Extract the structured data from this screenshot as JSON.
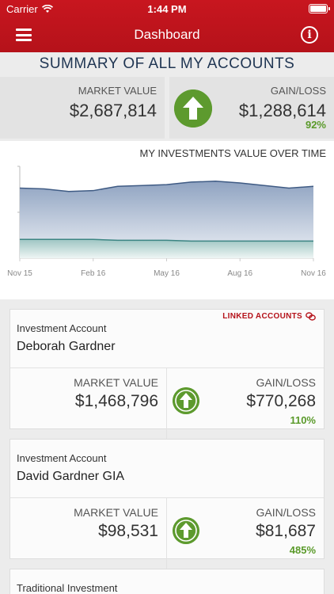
{
  "status": {
    "carrier": "Carrier",
    "time": "1:44 PM"
  },
  "header": {
    "title": "Dashboard"
  },
  "summary": {
    "title": "SUMMARY OF ALL MY ACCOUNTS",
    "market_value_label": "MARKET VALUE",
    "market_value": "$2,687,814",
    "gain_loss_label": "GAIN/LOSS",
    "gain_loss": "$1,288,614",
    "gain_loss_pct": "92%"
  },
  "chart_data": {
    "type": "area",
    "title": "MY INVESTMENTS VALUE OVER TIME",
    "x_tick_labels": [
      "Nov 15",
      "Feb 16",
      "May 16",
      "Aug 16",
      "Nov 16"
    ],
    "x_points": [
      "Nov 15",
      "Dec 15",
      "Jan 16",
      "Feb 16",
      "Mar 16",
      "Apr 16",
      "May 16",
      "Jun 16",
      "Jul 16",
      "Aug 16",
      "Sep 16",
      "Oct 16",
      "Nov 16"
    ],
    "series": [
      {
        "values": [
          0.82,
          0.81,
          0.78,
          0.79,
          0.84,
          0.85,
          0.86,
          0.89,
          0.9,
          0.88,
          0.85,
          0.82,
          0.84
        ],
        "color": "#3f5b84"
      },
      {
        "values": [
          0.22,
          0.22,
          0.22,
          0.22,
          0.21,
          0.21,
          0.21,
          0.2,
          0.2,
          0.2,
          0.2,
          0.2,
          0.2
        ],
        "color": "#3c8583"
      }
    ]
  },
  "accounts": [
    {
      "type": "Investment Account",
      "name": "Deborah Gardner",
      "linked_label": "LINKED ACCOUNTS",
      "market_value_label": "MARKET VALUE",
      "market_value": "$1,468,796",
      "gain_loss_label": "GAIN/LOSS",
      "gain_loss": "$770,268",
      "gain_loss_pct": "110%"
    },
    {
      "type": "Investment Account",
      "name": "David Gardner GIA",
      "market_value_label": "MARKET VALUE",
      "market_value": "$98,531",
      "gain_loss_label": "GAIN/LOSS",
      "gain_loss": "$81,687",
      "gain_loss_pct": "485%"
    },
    {
      "type": "Traditional Investment"
    }
  ],
  "icons": {
    "menu": "hamburger-menu-icon",
    "info": "info-icon",
    "gain": "arrow-up-circle-icon",
    "linked": "link-icon"
  },
  "colors": {
    "brand_red": "#b5121a",
    "positive_green": "#5d9a2e",
    "title_navy": "#1f3552"
  }
}
